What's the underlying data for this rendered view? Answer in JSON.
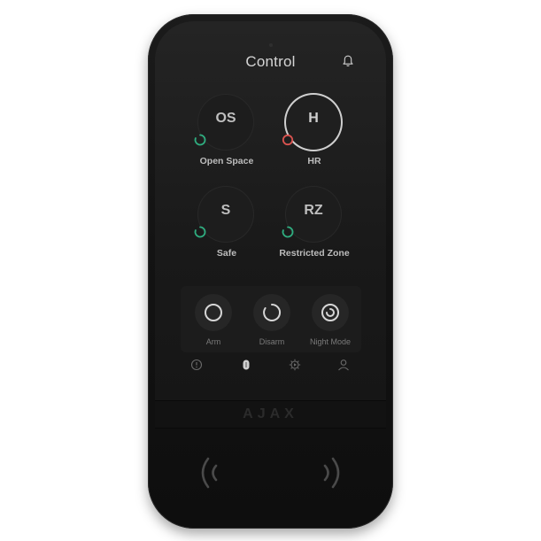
{
  "screen": {
    "title": "Control"
  },
  "header": {
    "notifications_icon": "bell-icon"
  },
  "groups": [
    {
      "abbr": "OS",
      "label": "Open Space",
      "status": "armed",
      "status_color": "#2fae80",
      "selected": false
    },
    {
      "abbr": "H",
      "label": "HR",
      "status": "disarmed",
      "status_color": "#d9534f",
      "selected": true
    },
    {
      "abbr": "S",
      "label": "Safe",
      "status": "armed",
      "status_color": "#2fae80",
      "selected": false
    },
    {
      "abbr": "RZ",
      "label": "Restricted Zone",
      "status": "armed",
      "status_color": "#2fae80",
      "selected": false
    }
  ],
  "actions": [
    {
      "label": "Arm",
      "icon": "arm-icon"
    },
    {
      "label": "Disarm",
      "icon": "disarm-icon"
    },
    {
      "label": "Night Mode",
      "icon": "night-mode-icon"
    }
  ],
  "nav": [
    {
      "icon": "alarm-icon"
    },
    {
      "icon": "groups-icon",
      "active": true
    },
    {
      "icon": "scenarios-icon"
    },
    {
      "icon": "user-icon"
    }
  ],
  "device": {
    "brand": "AJAX"
  },
  "colors": {
    "armed": "#2fae80",
    "disarmed": "#d9534f",
    "text": "#d4d4d4"
  }
}
